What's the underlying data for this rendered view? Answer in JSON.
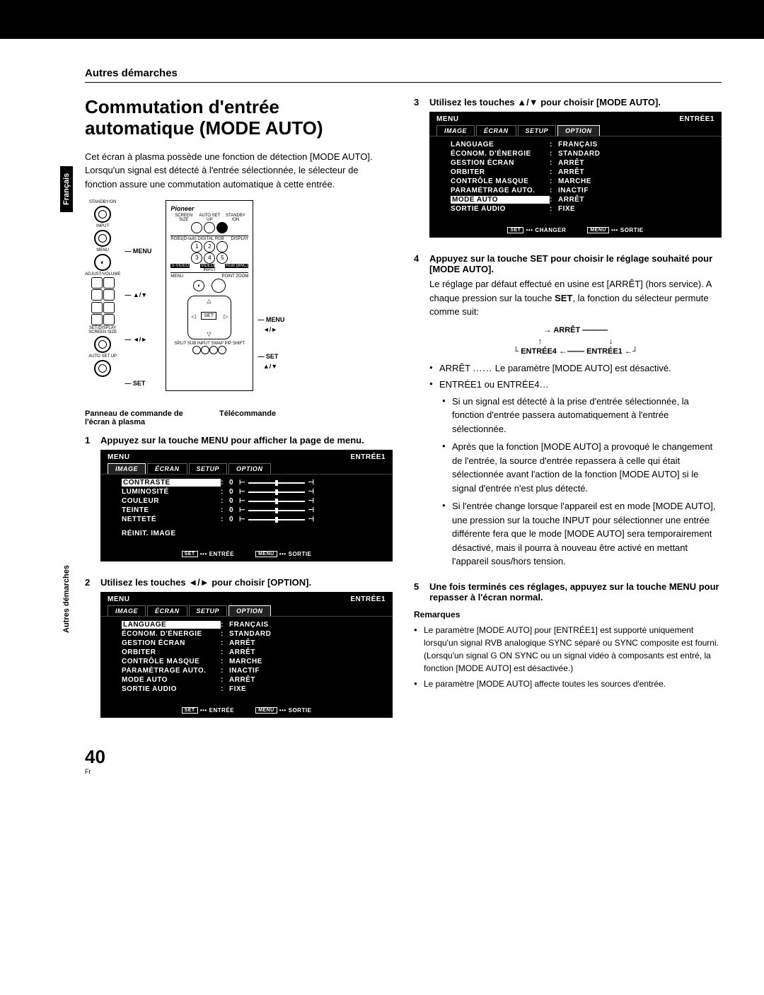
{
  "side_lang": "Français",
  "side_section": "Autres démarches",
  "header": "Autres démarches",
  "title": "Commutation d'entrée automatique (MODE AUTO)",
  "intro": "Cet écran à plasma possède une fonction de détection [MODE AUTO]. Lorsqu'un signal est détecté à l'entrée sélectionnée, le sélecteur de fonction assure une commutation automatique à cette entrée.",
  "panel_caption": "Panneau de commande de l'écran à plasma",
  "remote_caption": "Télécommande",
  "panel_labels": {
    "menu": "MENU",
    "arrows_ud": "▲/▼",
    "arrows_lr": "◄/►",
    "set": "SET"
  },
  "remote_labels": {
    "menu": "MENU",
    "arrows_lr": "◄/►",
    "set": "SET",
    "arrows_ud": "▲/▼"
  },
  "panel_text": {
    "standby": "STANDBY/ON",
    "input": "INPUT",
    "menu": "MENU",
    "adjust": "ADJUST/VOLUME",
    "setdisp": "SET/DISPLAY",
    "screensize": "SCREEN SIZE",
    "autosetup": "AUTO SET UP"
  },
  "remote_text": {
    "brand": "Pioneer",
    "screensize": "SCREEN SIZE",
    "autosetup": "AUTO SET UP",
    "standby": "STANDBY /ON",
    "display": "DISPLAY",
    "input": "INPUT",
    "svideo": "S-VIDEO",
    "video": "VIDEO",
    "rgbbnc": "RGB (BNC)",
    "menu": "MENU",
    "pointzoom": "POINT ZOOM",
    "set": "SET",
    "bottom": "SPLIT SUB INPUT SWAP PIP SHIFT"
  },
  "steps": [
    {
      "n": "1",
      "title": "Appuyez sur la touche MENU pour afficher la page de menu."
    },
    {
      "n": "2",
      "title": "Utilisez les touches ◄/► pour choisir [OPTION]."
    },
    {
      "n": "3",
      "title": "Utilisez les touches ▲/▼ pour choisir [MODE AUTO]."
    },
    {
      "n": "4",
      "title": "Appuyez sur la touche SET pour choisir le réglage souhaité pour [MODE AUTO].",
      "body": "Le réglage par défaut effectué en usine est [ARRÊT] (hors service). A chaque pression sur la touche ",
      "body_bold": "SET",
      "body2": ", la fonction du sélecteur permute comme suit:"
    },
    {
      "n": "5",
      "title": "Une fois terminés ces réglages, appuyez sur la touche MENU pour repasser à l'écran normal."
    }
  ],
  "cycle": {
    "arret": "ARRÊT",
    "e1": "ENTRÉE1",
    "e4": "ENTRÉE4"
  },
  "arret_line": {
    "label": "ARRÊT",
    "dots": "......",
    "text": "Le paramètre [MODE AUTO] est désactivé."
  },
  "entree_line": "ENTRÉE1 ou ENTRÉE4…",
  "sub_bullets": [
    "Si un signal est détecté à la prise d'entrée sélectionnée, la fonction d'entrée passera automatiquement à l'entrée sélectionnée.",
    "Après que la fonction [MODE AUTO] a provoqué le changement de l'entrée, la source d'entrée repassera à celle qui était sélectionnée avant l'action de la fonction [MODE AUTO] si le signal d'entrée n'est plus détecté.",
    "Si l'entrée change lorsque l'appareil est en mode [MODE AUTO], une pression sur la touche INPUT pour sélectionner une entrée différente fera que le mode [MODE AUTO] sera temporairement désactivé, mais il pourra à nouveau être activé en mettant l'appareil sous/hors tension."
  ],
  "remarques_head": "Remarques",
  "remarques": [
    "Le paramètre [MODE AUTO] pour [ENTRÉE1] est supporté uniquement lorsqu'un signal RVB analogique SYNC séparé ou SYNC composite est fourni. (Lorsqu'un signal G ON SYNC ou un signal vidéo à composants est entré, la fonction [MODE AUTO] est désactivée.)",
    "Le paramètre [MODE AUTO] affecte toutes les sources d'entrée."
  ],
  "osd_common": {
    "menu": "MENU",
    "entree": "ENTRÉE1",
    "tabs": [
      "IMAGE",
      "ÉCRAN",
      "SETUP",
      "OPTION"
    ],
    "footer_set": "SET",
    "footer_menu": "MENU",
    "footer_entree": "ENTRÉE",
    "footer_sortie": "SORTIE",
    "footer_changer": "CHANGER"
  },
  "osd_image": {
    "rows": [
      {
        "label": "CONTRASTE",
        "val": "0"
      },
      {
        "label": "LUMINOSITÉ",
        "val": "0"
      },
      {
        "label": "COULEUR",
        "val": "0"
      },
      {
        "label": "TEINTE",
        "val": "0"
      },
      {
        "label": "NETTETÉ",
        "val": "0"
      }
    ],
    "reinit": "RÉINIT. IMAGE"
  },
  "osd_option": {
    "rows": [
      {
        "label": "LANGUAGE",
        "val": "FRANÇAIS"
      },
      {
        "label": "ÉCONOM. D'ÉNERGIE",
        "val": "STANDARD"
      },
      {
        "label": "GESTION ÉCRAN",
        "val": "ARRÊT"
      },
      {
        "label": "ORBITER",
        "val": "ARRÊT"
      },
      {
        "label": "CONTRÔLE MASQUE",
        "val": "MARCHE"
      },
      {
        "label": "PARAMÉTRAGE AUTO.",
        "val": "INACTIF"
      },
      {
        "label": "MODE AUTO",
        "val": "ARRÊT"
      },
      {
        "label": "SORTIE AUDIO",
        "val": "FIXE"
      }
    ]
  },
  "page_num": "40",
  "page_num_sub": "Fr"
}
